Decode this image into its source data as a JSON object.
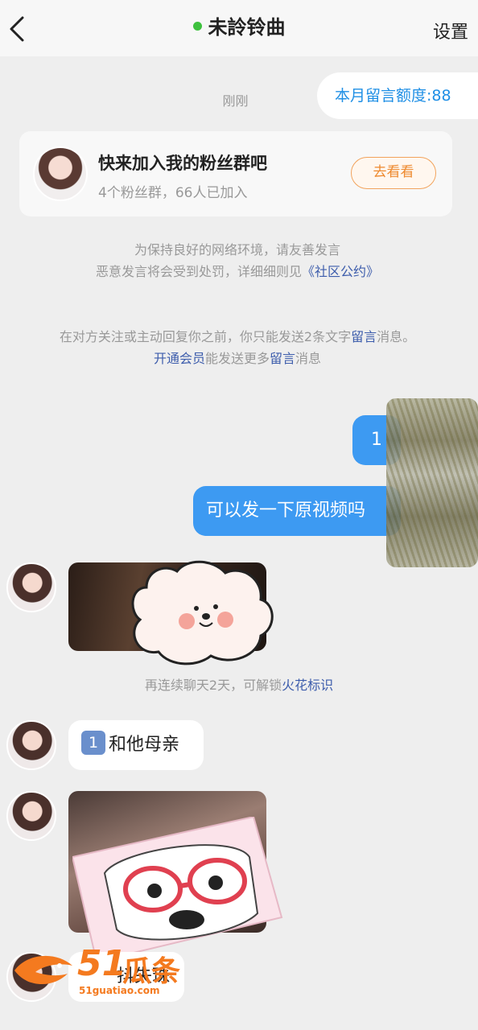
{
  "header": {
    "back_icon": "chevron-left-icon",
    "title": "未詅铃曲",
    "settings_label": "设置",
    "status_color": "#3ec13e"
  },
  "time_label": "刚刚",
  "quota_label": "本月留言额度:88",
  "fan_card": {
    "title": "快来加入我的粉丝群吧",
    "subtitle": "4个粉丝群，66人已加入",
    "button": "去看看"
  },
  "notices": {
    "line1": "为保持良好的网络环境，请友善发言",
    "line2_prefix": "恶意发言将会受到处罚，详细细则见",
    "line2_link": "《社区公约》",
    "limit_prefix": "在对方关注或主动回复你之前，你只能发送2条文字",
    "limit_link": "留言",
    "limit_suffix": "消息。",
    "vip_link": "开通会员",
    "vip_mid": "能发送更多",
    "vip_link2": "留言",
    "vip_suffix": "消息"
  },
  "messages": {
    "sent1": "1",
    "sent2": "可以发一下原视频吗",
    "spark_prefix": "再连续聊天2天，可解锁",
    "spark_link": "火花标识",
    "recv_keycap": "1",
    "recv_text": "和他母亲",
    "recv_last": "抖失珠"
  },
  "watermark": {
    "num": "51",
    "cn": "瓜条",
    "url": "51guatiao.com"
  },
  "colors": {
    "accent_blue": "#3d9af2",
    "link_blue": "#3d5dac",
    "orange": "#ee8a2f"
  }
}
